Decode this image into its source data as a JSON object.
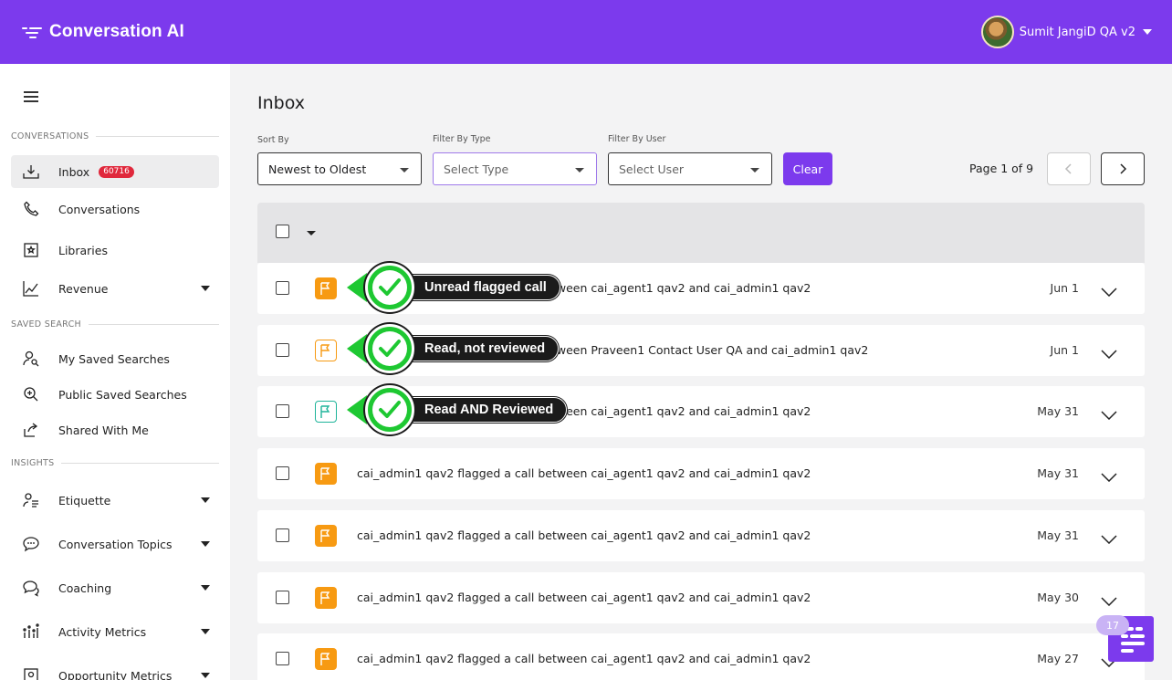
{
  "app": {
    "title": "Conversation AI"
  },
  "user": {
    "name": "Sumit JangiD QA v2"
  },
  "sidebar": {
    "sections": {
      "conversations": "CONVERSATIONS",
      "saved_search": "SAVED SEARCH",
      "insights": "INSIGHTS"
    },
    "items": [
      {
        "label": "Inbox",
        "badge": "60716",
        "icon": "inbox-icon"
      },
      {
        "label": "Conversations",
        "icon": "phone-icon"
      },
      {
        "label": "Libraries",
        "icon": "library-icon"
      },
      {
        "label": "Revenue",
        "icon": "chart-icon"
      },
      {
        "label": "My Saved Searches",
        "icon": "user-search-icon"
      },
      {
        "label": "Public Saved Searches",
        "icon": "zoom-in-icon"
      },
      {
        "label": "Shared With Me",
        "icon": "share-icon"
      },
      {
        "label": "Etiquette",
        "icon": "etiquette-icon"
      },
      {
        "label": "Conversation Topics",
        "icon": "topics-icon"
      },
      {
        "label": "Coaching",
        "icon": "coaching-icon"
      },
      {
        "label": "Activity Metrics",
        "icon": "activity-icon"
      },
      {
        "label": "Opportunity Metrics",
        "icon": "opportunity-icon"
      }
    ]
  },
  "main": {
    "title": "Inbox",
    "filters": {
      "sort_label": "Sort By",
      "sort_value": "Newest to Oldest",
      "type_label": "Filter By Type",
      "type_placeholder": "Select Type",
      "user_label": "Filter By User",
      "user_placeholder": "Select User",
      "clear_label": "Clear"
    },
    "pagination": {
      "text": "Page 1 of 9"
    },
    "rows": [
      {
        "text": "cai_admin1 qav2 flagged a call between cai_agent1 qav2 and cai_admin1 qav2",
        "date": "Jun 1",
        "flag": "unread"
      },
      {
        "text": "cai_admin1 qav2 flagged a call between Praveen1 Contact User QA and cai_admin1 qav2",
        "date": "Jun 1",
        "flag": "read"
      },
      {
        "text": "cai_admin1 qav2 flagged a call between cai_agent1 qav2 and cai_admin1 qav2",
        "date": "May 31",
        "flag": "reviewed"
      },
      {
        "text": "cai_admin1 qav2 flagged a call between cai_agent1 qav2 and cai_admin1 qav2",
        "date": "May 31",
        "flag": "unread"
      },
      {
        "text": "cai_admin1 qav2 flagged a call between cai_agent1 qav2 and cai_admin1 qav2",
        "date": "May 31",
        "flag": "unread"
      },
      {
        "text": "cai_admin1 qav2 flagged a call between cai_agent1 qav2 and cai_admin1 qav2",
        "date": "May 30",
        "flag": "unread"
      },
      {
        "text": "cai_admin1 qav2 flagged a call between cai_agent1 qav2 and cai_admin1 qav2",
        "date": "May 27",
        "flag": "unread"
      }
    ]
  },
  "annotations": [
    {
      "label": "Unread flagged call"
    },
    {
      "label": "Read, not reviewed"
    },
    {
      "label": "Read AND Reviewed"
    }
  ],
  "chat": {
    "count": "17"
  },
  "colors": {
    "brand": "#7c3aed",
    "flag_orange": "#f79a12",
    "flag_teal": "#1fb49a",
    "badge_red": "#e0283c",
    "callout_green": "#1ec832"
  }
}
